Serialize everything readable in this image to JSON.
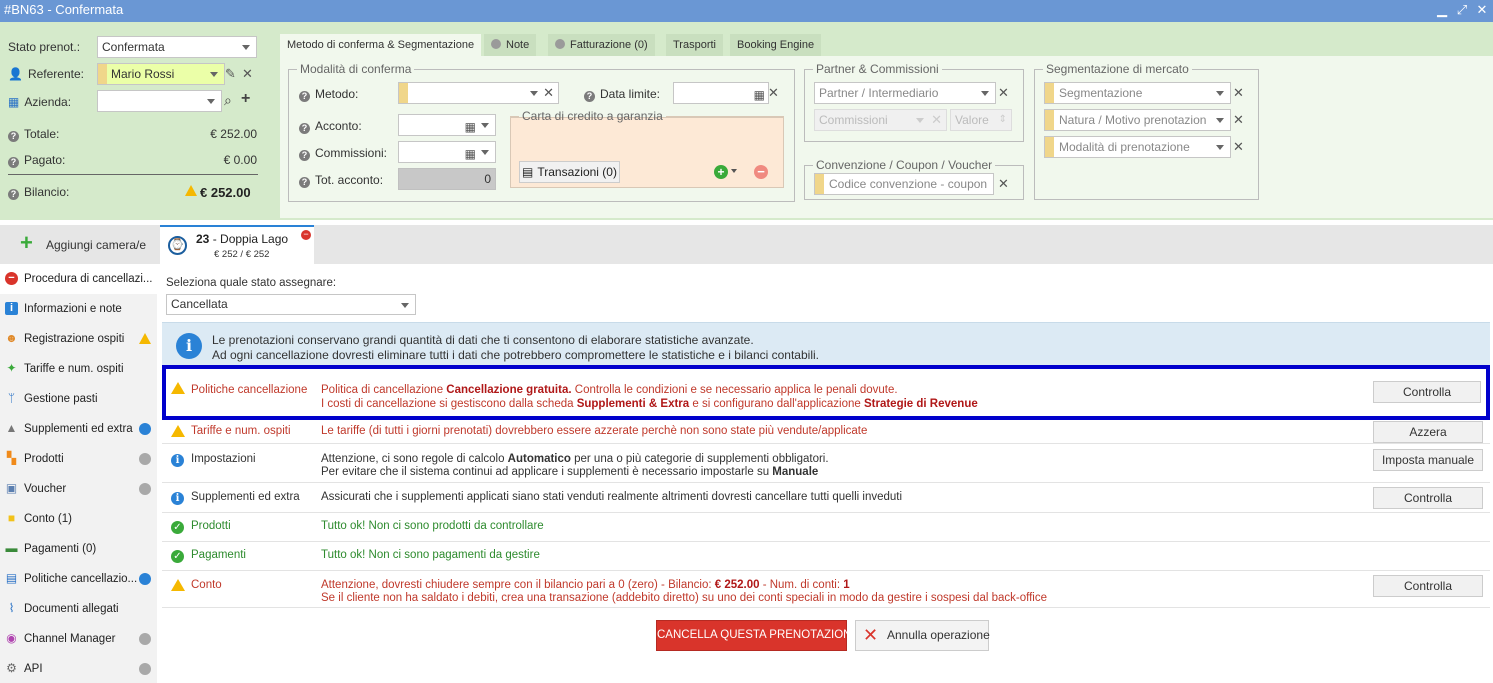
{
  "window": {
    "title": "#BN63 - Confermata",
    "controls": [
      "minimize-icon",
      "maximize-icon",
      "close-icon"
    ]
  },
  "summary": {
    "stato_label": "Stato prenot.:",
    "stato_value": "Confermata",
    "referente_label": "Referente:",
    "referente_value": "Mario Rossi",
    "azienda_label": "Azienda:",
    "azienda_value": "",
    "totale_label": "Totale:",
    "totale_value": "€ 252.00",
    "pagato_label": "Pagato:",
    "pagato_value": "€ 0.00",
    "bilancio_label": "Bilancio:",
    "bilancio_value": "€ 252.00"
  },
  "tabs": [
    {
      "label": "Metodo di conferma & Segmentazione",
      "active": true
    },
    {
      "label": "Note"
    },
    {
      "label": "Fatturazione (0)"
    },
    {
      "label": "Trasporti"
    },
    {
      "label": "Booking Engine"
    }
  ],
  "conferma": {
    "legend": "Modalità di conferma",
    "metodo_label": "Metodo:",
    "data_limite_label": "Data limite:",
    "acconto_label": "Acconto:",
    "commissioni_label": "Commissioni:",
    "tot_acconto_label": "Tot. acconto:",
    "tot_acconto_value": "0",
    "carta_legend": "Carta di credito a garanzia",
    "transazioni_label": "Transazioni (0)"
  },
  "partner": {
    "legend": "Partner & Commissioni",
    "intermediario_placeholder": "Partner / Intermediario",
    "commissioni_placeholder": "Commissioni",
    "valore_placeholder": "Valore"
  },
  "convenzione": {
    "legend": "Convenzione / Coupon / Voucher",
    "codice_placeholder": "Codice convenzione - coupon"
  },
  "segmentazione": {
    "legend": "Segmentazione di mercato",
    "fields": [
      "Segmentazione",
      "Natura / Motivo prenotazion",
      "Modalità di prenotazione"
    ]
  },
  "rooms": {
    "add_label": "Aggiungi camera/e",
    "room_number": "23",
    "room_name": " - Doppia Lago",
    "room_price": "€ 252 / € 252"
  },
  "sidebar": {
    "items": [
      {
        "label": "Procedura di cancellazi...",
        "icon": "minus-circle-icon",
        "status": ""
      },
      {
        "label": "Informazioni e note",
        "icon": "info-icon",
        "status": ""
      },
      {
        "label": "Registrazione ospiti",
        "icon": "user-icon",
        "status": "warning"
      },
      {
        "label": "Tariffe e num. ospiti",
        "icon": "tag-icon",
        "status": ""
      },
      {
        "label": "Gestione pasti",
        "icon": "cutlery-icon",
        "status": ""
      },
      {
        "label": "Supplementi ed extra",
        "icon": "service-bell-icon",
        "status": "blue"
      },
      {
        "label": "Prodotti",
        "icon": "boxes-icon",
        "status": "grey"
      },
      {
        "label": "Voucher",
        "icon": "voucher-icon",
        "status": "grey"
      },
      {
        "label": "Conto (1)",
        "icon": "folder-icon",
        "status": ""
      },
      {
        "label": "Pagamenti (0)",
        "icon": "money-icon",
        "status": ""
      },
      {
        "label": "Politiche cancellazio...",
        "icon": "document-icon",
        "status": "blue"
      },
      {
        "label": "Documenti allegati",
        "icon": "paperclip-icon",
        "status": ""
      },
      {
        "label": "Channel Manager",
        "icon": "broadcast-icon",
        "status": "grey"
      },
      {
        "label": "API",
        "icon": "gear-icon",
        "status": "grey"
      }
    ]
  },
  "cancellation": {
    "select_label": "Seleziona quale stato assegnare:",
    "select_value": "Cancellata",
    "info_line1": "Le prenotazioni conservano grandi quantità di dati che ti consentono di elaborare statistiche avanzate.",
    "info_line2": "Ad ogni cancellazione dovresti eliminare tutti i dati che potrebbero compromettere le statistiche e i bilanci contabili.",
    "checks": [
      {
        "label": "Politiche cancellazione",
        "type": "warning",
        "l1a": "Politica di cancellazione ",
        "l1b": "Cancellazione gratuita.",
        "l1c": " Controlla le condizioni e se necessario applica le penali dovute.",
        "l2a": "I costi di cancellazione si gestiscono dalla scheda ",
        "l2b": "Supplementi & Extra",
        "l2c": " e si configurano dall'applicazione ",
        "l2d": "Strategie di Revenue",
        "button": "Controlla"
      },
      {
        "label": "Tariffe e num. ospiti",
        "type": "warning",
        "text": "Le tariffe (di tutti i giorni prenotati) dovrebbero essere azzerate perchè non sono state più vendute/applicate",
        "button": "Azzera"
      },
      {
        "label": "Impostazioni",
        "type": "info",
        "l1a": "Attenzione, ci sono regole di calcolo ",
        "l1b": "Automatico",
        "l1c": " per una o più categorie di supplementi obbligatori.",
        "l2a": "Per evitare che il sistema continui ad applicare i supplementi è necessario impostarle su ",
        "l2b": "Manuale",
        "button": "Imposta manuale"
      },
      {
        "label": "Supplementi ed extra",
        "type": "info",
        "text": "Assicurati che i supplementi applicati siano stati venduti realmente altrimenti dovresti cancellare tutti quelli inveduti",
        "button": "Controlla"
      },
      {
        "label": "Prodotti",
        "type": "ok",
        "text": "Tutto ok! Non ci sono prodotti da controllare"
      },
      {
        "label": "Pagamenti",
        "type": "ok",
        "text": "Tutto ok! Non ci sono pagamenti da gestire"
      },
      {
        "label": "Conto",
        "type": "warning",
        "l1a": "Attenzione, dovresti chiudere sempre con il bilancio pari a 0 (zero) - Bilancio: ",
        "l1b": "€ 252.00",
        "l1c": " - Num. di conti: ",
        "l1d": "1",
        "l2a": "Se il cliente non ha saldato i debiti, crea una transazione (addebito diretto) su uno dei conti speciali in modo da gestire i sospesi dal back-office",
        "button": "Controlla"
      }
    ],
    "cancel_button": "CANCELLA QUESTA PRENOTAZIONE",
    "abort_button": "Annulla operazione"
  },
  "colors": {
    "header_bg": "#d5eacb",
    "title_bg": "#6a97d4",
    "highlight": "#0000cc",
    "danger": "#d9342b",
    "info": "#2a82d6"
  }
}
